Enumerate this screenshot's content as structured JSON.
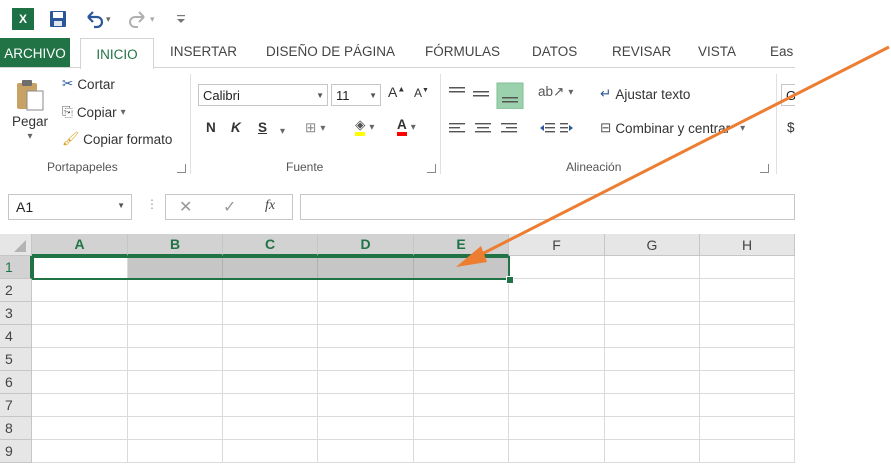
{
  "app": {
    "logo_text": "X",
    "accent_color": "#217346",
    "annotation_color": "#ed7d31"
  },
  "tabs": [
    {
      "label": "ARCHIVO"
    },
    {
      "label": "INICIO"
    },
    {
      "label": "INSERTAR"
    },
    {
      "label": "DISEÑO DE PÁGINA"
    },
    {
      "label": "FÓRMULAS"
    },
    {
      "label": "DATOS"
    },
    {
      "label": "REVISAR"
    },
    {
      "label": "VISTA"
    },
    {
      "label": "Eas"
    }
  ],
  "ribbon": {
    "clipboard": {
      "paste": "Pegar",
      "cut": "Cortar",
      "copy": "Copiar",
      "format_painter": "Copiar formato",
      "group_label": "Portapapeles"
    },
    "font": {
      "name": "Calibri",
      "size": "11",
      "bold": "N",
      "italic": "K",
      "underline": "S",
      "group_label": "Fuente"
    },
    "alignment": {
      "wrap_text": "Ajustar texto",
      "merge_center": "Combinar y centrar",
      "group_label": "Alineación"
    },
    "number": {
      "format_value": "G",
      "currency": "$"
    }
  },
  "formula_bar": {
    "name_box": "A1",
    "fx": "fx",
    "content": ""
  },
  "sheet": {
    "columns": [
      "A",
      "B",
      "C",
      "D",
      "E",
      "F",
      "G",
      "H"
    ],
    "rows": [
      "1",
      "2",
      "3",
      "4",
      "5",
      "6",
      "7",
      "8",
      "9"
    ],
    "selection": "A1:E1"
  }
}
